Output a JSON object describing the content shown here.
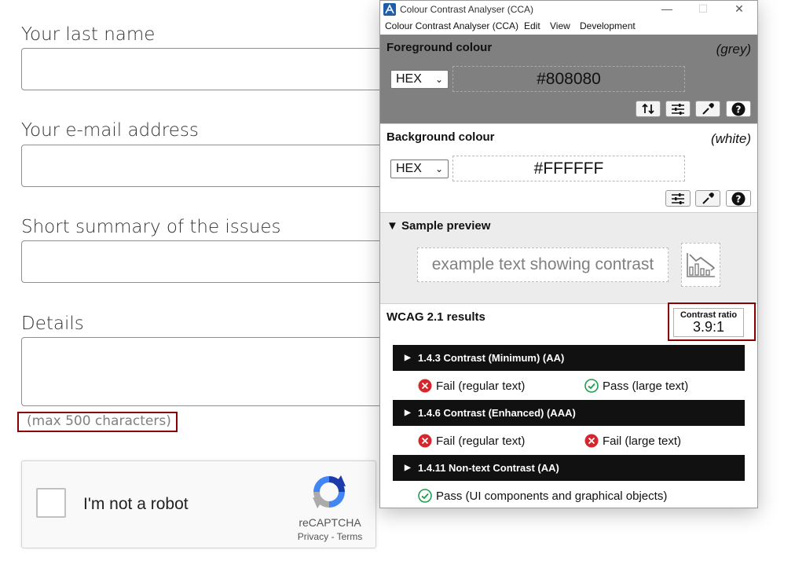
{
  "form": {
    "last_name_label": "Your last name",
    "email_label": "Your e-mail address",
    "summary_label": "Short summary of the issues",
    "details_label": "Details",
    "details_hint": "(max 500 characters)",
    "captcha": {
      "label": "I'm not a robot",
      "brand": "reCAPTCHA",
      "privacy": "Privacy",
      "separator": " - ",
      "terms": "Terms"
    }
  },
  "cca": {
    "title": "Colour Contrast Analyser (CCA)",
    "window_controls": {
      "minimize": "—",
      "maximize": "☐",
      "close": "✕"
    },
    "menu": [
      "Colour Contrast Analyser (CCA)",
      "Edit",
      "View",
      "Development"
    ],
    "foreground": {
      "title": "Foreground colour",
      "name": "(grey)",
      "format": "HEX",
      "value": "#808080",
      "color": "#808080"
    },
    "background": {
      "title": "Background colour",
      "name": "(white)",
      "format": "HEX",
      "value": "#FFFFFF",
      "color": "#FFFFFF"
    },
    "preview": {
      "title": "Sample preview",
      "text": "example text showing contrast"
    },
    "results": {
      "title": "WCAG 2.1 results",
      "ratio_label": "Contrast ratio",
      "ratio_value": "3.9:1",
      "criteria": [
        {
          "label": "1.4.3 Contrast (Minimum) (AA)",
          "results": [
            {
              "status": "fail",
              "text": "Fail (regular text)"
            },
            {
              "status": "pass",
              "text": "Pass (large text)"
            }
          ]
        },
        {
          "label": "1.4.6 Contrast (Enhanced) (AAA)",
          "results": [
            {
              "status": "fail",
              "text": "Fail (regular text)"
            },
            {
              "status": "fail",
              "text": "Fail (large text)"
            }
          ]
        },
        {
          "label": "1.4.11 Non-text Contrast (AA)",
          "results": [
            {
              "status": "pass",
              "text": "Pass (UI components and graphical objects)"
            }
          ]
        }
      ]
    }
  },
  "colors": {
    "highlight_outline": "#8b0000",
    "fail_icon": "#d6262b",
    "pass_icon": "#1e9e4a",
    "criterion_bar": "#111111"
  }
}
